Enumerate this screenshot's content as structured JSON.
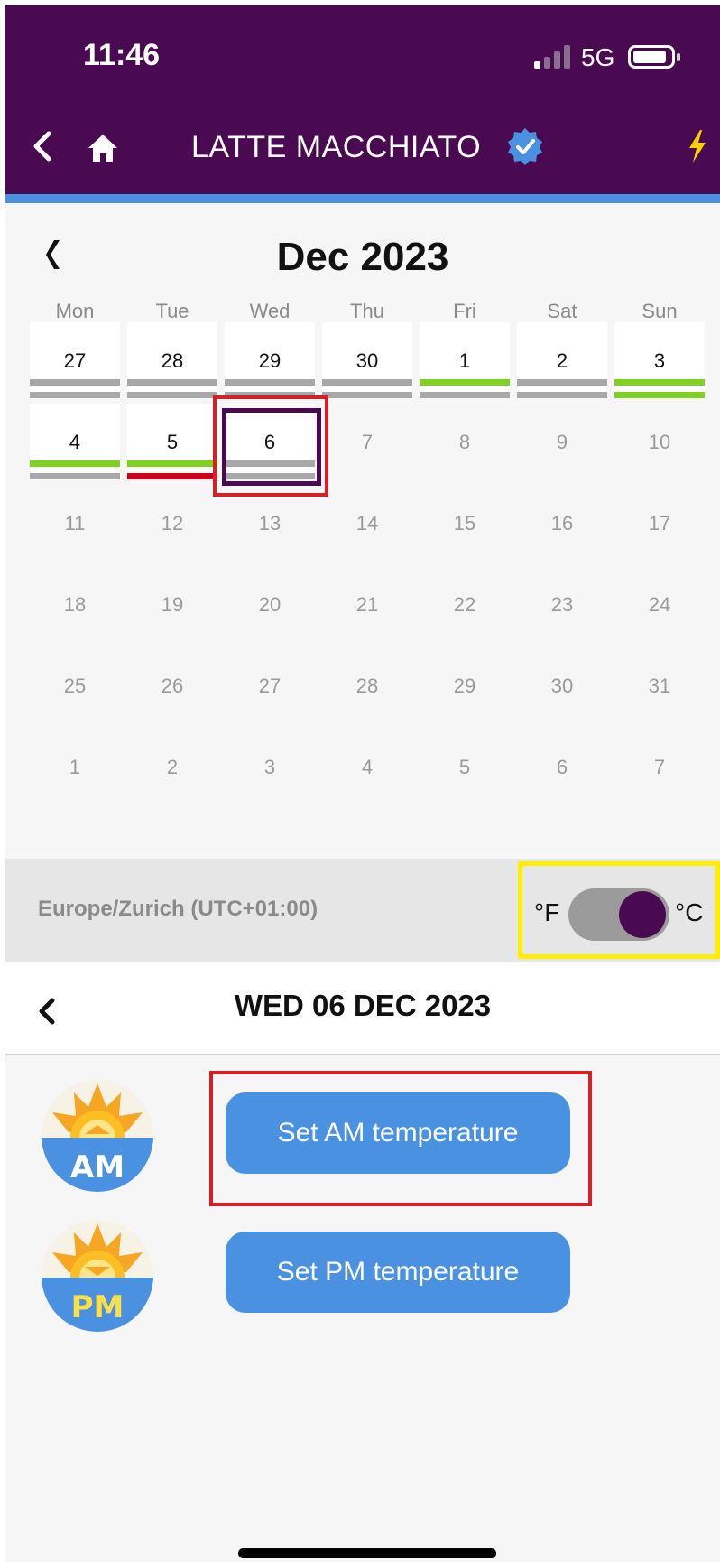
{
  "status_bar": {
    "time": "11:46",
    "network": "5G"
  },
  "header": {
    "title": "LATTE MACCHIATO"
  },
  "calendar": {
    "month_title": "Dec 2023",
    "weekdays": [
      "Mon",
      "Tue",
      "Wed",
      "Thu",
      "Fri",
      "Sat",
      "Sun"
    ],
    "selected_day": "6",
    "weeks": [
      [
        "27",
        "28",
        "29",
        "30",
        "1",
        "2",
        "3"
      ],
      [
        "4",
        "5",
        "6",
        "7",
        "8",
        "9",
        "10"
      ],
      [
        "11",
        "12",
        "13",
        "14",
        "15",
        "16",
        "17"
      ],
      [
        "18",
        "19",
        "20",
        "21",
        "22",
        "23",
        "24"
      ],
      [
        "25",
        "26",
        "27",
        "28",
        "29",
        "30",
        "31"
      ],
      [
        "1",
        "2",
        "3",
        "4",
        "5",
        "6",
        "7"
      ]
    ]
  },
  "timezone": {
    "label": "Europe/Zurich (UTC+01:00)"
  },
  "units": {
    "left": "°F",
    "right": "°C",
    "selected": "°C"
  },
  "day_view": {
    "date": "WED 06 DEC 2023"
  },
  "actions": {
    "am_badge": "AM",
    "pm_badge": "PM",
    "am_button": "Set AM temperature",
    "pm_button": "Set PM temperature"
  },
  "colors": {
    "brand": "#4a0a51",
    "accent": "#4b91e2",
    "green": "#7ed321",
    "red": "#d0021b",
    "gray": "#a8a8a8"
  }
}
